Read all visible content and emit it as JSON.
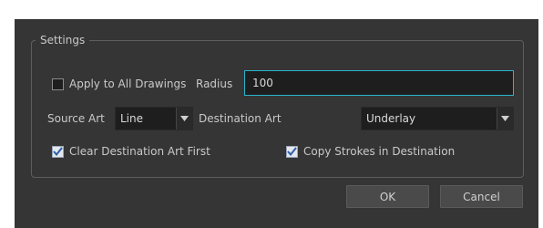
{
  "settings": {
    "group_title": "Settings",
    "apply_all_label": "Apply to All Drawings",
    "apply_all_checked": false,
    "radius_label": "Radius",
    "radius_value": "100",
    "source_art_label": "Source Art",
    "source_art_value": "Line",
    "destination_art_label": "Destination Art",
    "destination_art_value": "Underlay",
    "clear_destination_label": "Clear Destination Art First",
    "clear_destination_checked": true,
    "copy_strokes_label": "Copy Strokes in Destination",
    "copy_strokes_checked": true
  },
  "buttons": {
    "ok_label": "OK",
    "cancel_label": "Cancel"
  },
  "colors": {
    "background": "#353535",
    "field_background": "#1e1e1e",
    "focus_border": "#2ab3cc",
    "button_background": "#4a4a4a"
  }
}
